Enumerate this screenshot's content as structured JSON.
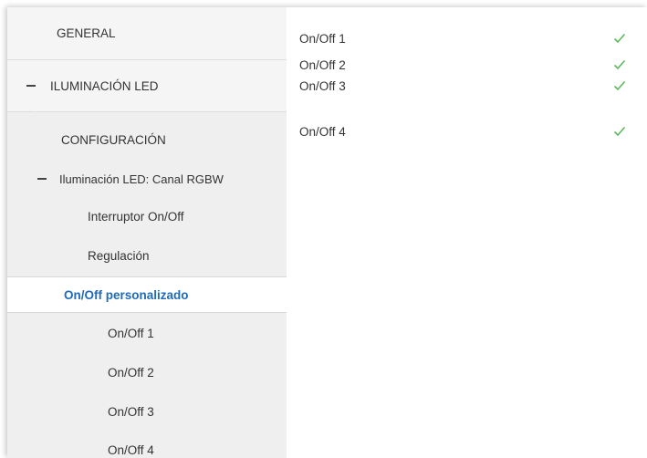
{
  "sidebar": {
    "general": "GENERAL",
    "iluminacion_led": "ILUMINACIÓN LED",
    "configuracion": "CONFIGURACIÓN",
    "canal_rgbw": "Iluminación LED: Canal RGBW",
    "interruptor": "Interruptor On/Off",
    "regulacion": "Regulación",
    "personalizado": "On/Off personalizado",
    "sub_items": [
      "On/Off 1",
      "On/Off 2",
      "On/Off 3",
      "On/Off 4"
    ]
  },
  "main": {
    "rows": [
      {
        "label": "On/Off 1",
        "checked": true
      },
      {
        "label": "On/Off 2",
        "checked": true
      },
      {
        "label": "On/Off 3",
        "checked": true
      },
      {
        "label": "On/Off 4",
        "checked": true
      }
    ],
    "check_color": "#5cb85c"
  },
  "colors": {
    "accent": "#1f6bb8",
    "sidebar_bg": "#efefef"
  }
}
